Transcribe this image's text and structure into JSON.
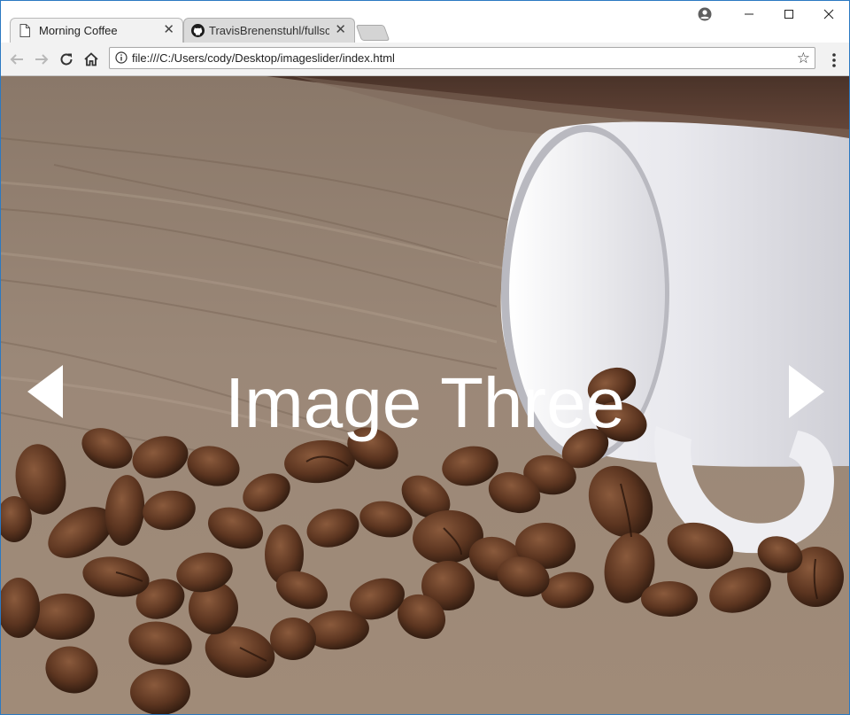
{
  "browser": {
    "tabs": [
      {
        "title": "Morning Coffee",
        "active": true,
        "icon": "page-icon"
      },
      {
        "title": "TravisBrenenstuhl/fullscre",
        "active": false,
        "icon": "github-icon"
      }
    ],
    "address": "file:///C:/Users/cody/Desktop/imageslider/index.html"
  },
  "slider": {
    "caption": "Image Three",
    "prev_icon": "triangle-left-icon",
    "next_icon": "triangle-right-icon"
  },
  "colors": {
    "accent_border": "#2b79c2",
    "caption": "#ffffff"
  }
}
